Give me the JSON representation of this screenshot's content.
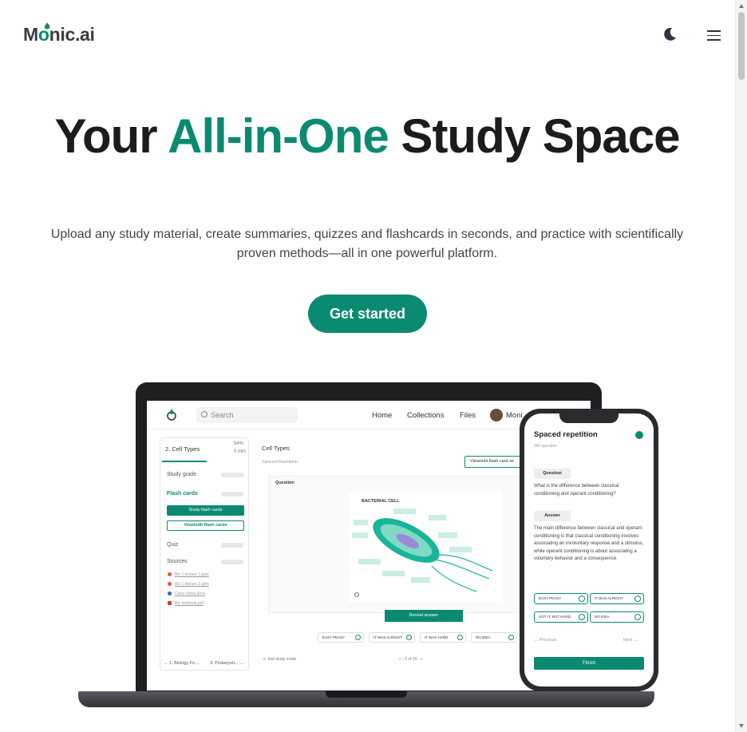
{
  "header": {
    "logo_prefix": "M",
    "logo_o": "o",
    "logo_suffix": "nic.ai",
    "theme_toggle_icon": "moon-icon",
    "menu_icon": "hamburger-menu-icon"
  },
  "hero": {
    "title_part1": "Your",
    "title_accent": "All-in-One",
    "title_part2": "Study Space",
    "subtitle": "Upload any study material, create summaries, quizzes and flashcards in seconds, and practice with scientifically proven methods—all in one powerful platform.",
    "cta_label": "Get started"
  },
  "colors": {
    "accent": "#0b8a72",
    "text": "#1c1c1c"
  },
  "mockup": {
    "search_placeholder": "Search",
    "nav": [
      "Home",
      "Collections",
      "Files"
    ],
    "user": "Moni",
    "side_title": "2. Cell Types",
    "side_pct": "54%",
    "side_time": "0 min",
    "side_items": [
      "Study guide",
      "Flash cards",
      "Quiz",
      "Sources"
    ],
    "study_btn": "Study flash cards",
    "view_btn": "View/edit flash cards",
    "sources": [
      "Bio 1 lecture 1.pptx",
      "Bio 1 lecture 2.pptx",
      "Class notes.docx",
      "Bio textbook.pdf"
    ],
    "side_foot_prev": "1. Biology Fo...",
    "side_foot_next": "3. Prokaryoti...",
    "main_title": "Cell Types",
    "main_sub": "Spaced Repetition",
    "main_btn": "View/edit flash card se",
    "question_label": "Question",
    "cell_label": "BACTERIAL CELL",
    "reveal_btn": "Reveal answer",
    "ratings": [
      "EASY PEASY",
      "IT WAS ALRIGHT",
      "IT WAS HARD",
      "NO IDEA"
    ],
    "exit": "Exit study mode",
    "pager": "1 of 20"
  },
  "phone": {
    "title": "Spaced repetition",
    "count": "260 question",
    "question_tag": "Question",
    "question": "What is the difference between classical conditioning and operant conditioning?",
    "answer_tag": "Answer",
    "answer": "The main difference between classical and operant conditioning is that classical conditioning involves associating an involuntary response and a stimulus, while operant conditioning is about associating a voluntary behavior and a consequence.",
    "ratings": [
      "EASY PEASY",
      "IT WAS ALRIGHT",
      "GOT IT, BUT HARD",
      "NO IDEA"
    ],
    "prev": "Previous",
    "next": "Next",
    "finish": "Finish"
  }
}
